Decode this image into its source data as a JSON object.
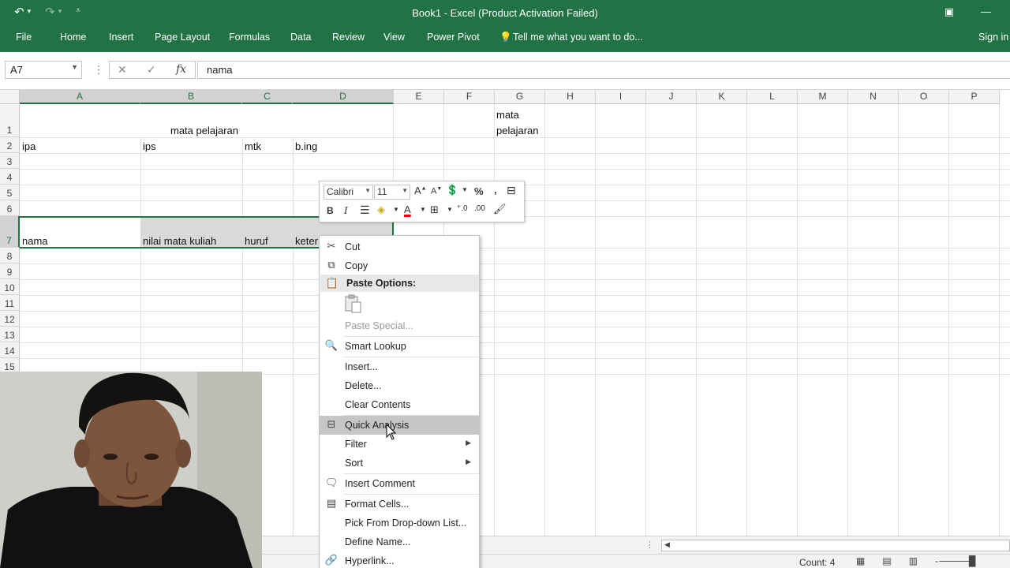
{
  "window": {
    "title": "Book1 - Excel (Product Activation Failed)",
    "sign_in": "Sign in"
  },
  "ribbon": {
    "tabs": [
      "File",
      "Home",
      "Insert",
      "Page Layout",
      "Formulas",
      "Data",
      "Review",
      "View",
      "Power Pivot"
    ],
    "tell_me": "Tell me what you want to do..."
  },
  "formula_bar": {
    "name_box": "A7",
    "content": "nama"
  },
  "columns": [
    "A",
    "B",
    "C",
    "D",
    "E",
    "F",
    "G",
    "H",
    "I",
    "J",
    "K",
    "L",
    "M",
    "N",
    "O",
    "P"
  ],
  "rows": [
    "1",
    "2",
    "3",
    "4",
    "5",
    "6",
    "7",
    "8",
    "9",
    "10",
    "11",
    "12",
    "13",
    "14",
    "15"
  ],
  "cells": {
    "r1_merged": "mata pelajaran",
    "g1_line1": "mata",
    "g1_line2": "pelajaran",
    "a2": "ipa",
    "b2": "ips",
    "c2": "mtk",
    "d2": "b.ing",
    "a7": "nama",
    "b7": "nilai mata kuliah",
    "c7": "huruf",
    "d7": "keter"
  },
  "mini_toolbar": {
    "font": "Calibri",
    "size": "11",
    "percent": "%",
    "comma": ",",
    "bold": "B",
    "italic": "I",
    "font_color_letter": "A"
  },
  "context_menu": {
    "items": [
      {
        "label": "Cut",
        "icon": "scissors-icon"
      },
      {
        "label": "Copy",
        "icon": "copy-icon"
      },
      {
        "label": "Paste Options:",
        "icon": "paste-icon"
      },
      {
        "label": "Paste Special...",
        "icon": ""
      },
      {
        "label": "Smart Lookup",
        "icon": "search-icon"
      },
      {
        "label": "Insert...",
        "icon": ""
      },
      {
        "label": "Delete...",
        "icon": ""
      },
      {
        "label": "Clear Contents",
        "icon": ""
      },
      {
        "label": "Quick Analysis",
        "icon": "quick-analysis-icon"
      },
      {
        "label": "Filter",
        "icon": ""
      },
      {
        "label": "Sort",
        "icon": ""
      },
      {
        "label": "Insert Comment",
        "icon": "comment-icon"
      },
      {
        "label": "Format Cells...",
        "icon": "format-cells-icon"
      },
      {
        "label": "Pick From Drop-down List...",
        "icon": ""
      },
      {
        "label": "Define Name...",
        "icon": ""
      },
      {
        "label": "Hyperlink...",
        "icon": "hyperlink-icon"
      }
    ]
  },
  "status_bar": {
    "count": "Count: 4"
  },
  "colors": {
    "excel_green": "#217346",
    "selection_gray": "#d9d9d9",
    "menu_hover": "#c6c6c6"
  }
}
